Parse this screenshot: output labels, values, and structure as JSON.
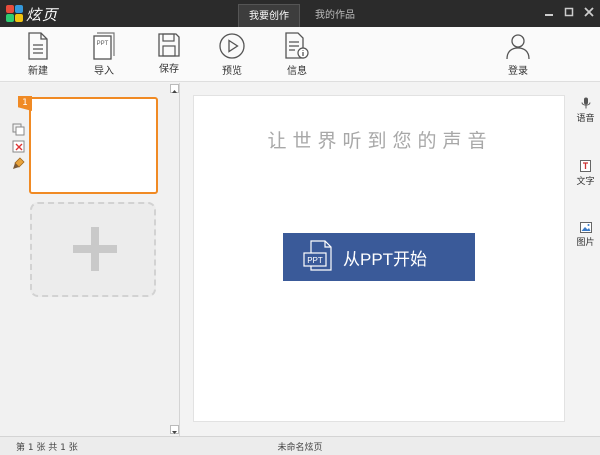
{
  "app": {
    "logo_text": "炫页"
  },
  "tabs": [
    {
      "label": "我要创作",
      "active": true
    },
    {
      "label": "我的作品",
      "active": false
    }
  ],
  "toolbar": {
    "new_label": "新建",
    "import_label": "导入",
    "import_icon_text": "PPT",
    "save_label": "保存",
    "preview_label": "预览",
    "info_label": "信息",
    "login_label": "登录"
  },
  "slides": {
    "current_number": "1"
  },
  "canvas": {
    "slogan": "让世界听到您的声音",
    "ppt_button_label": "从PPT开始",
    "ppt_icon_text": "PPT"
  },
  "right_panel": {
    "voice_label": "语音",
    "text_label": "文字",
    "image_label": "图片"
  },
  "status": {
    "page_info": "第 1 张  共 1 张",
    "document_name": "未命名炫页"
  },
  "colors": {
    "accent_orange": "#f08a24",
    "ppt_button_blue": "#3a5a99",
    "titlebar": "#2b2b2b"
  }
}
